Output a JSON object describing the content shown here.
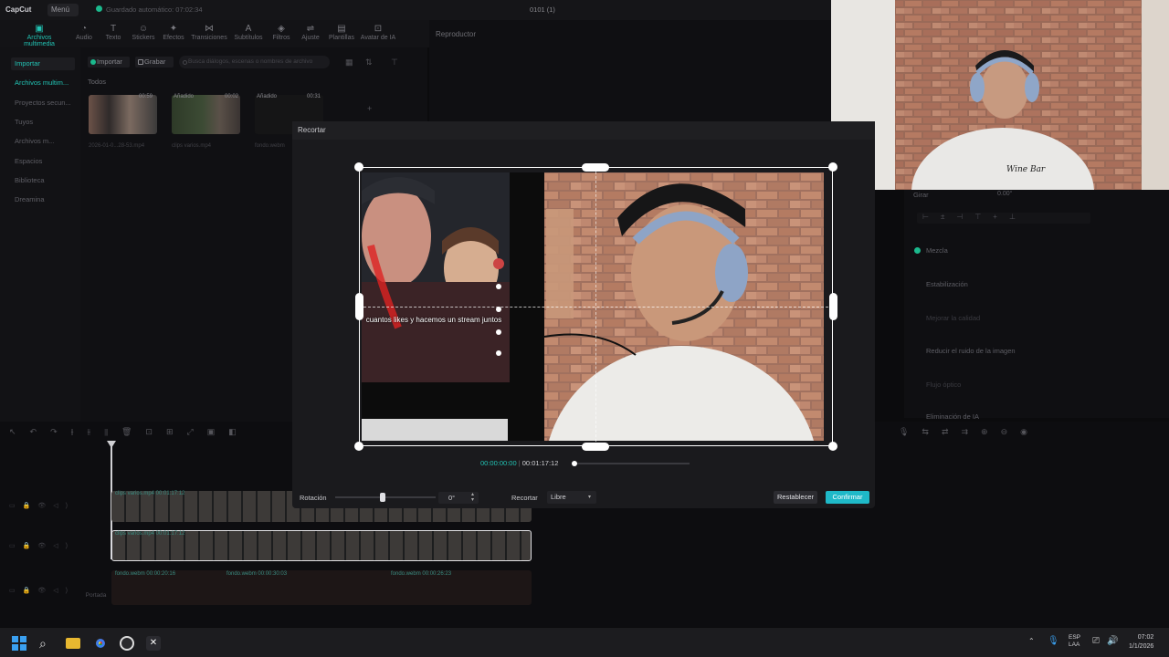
{
  "app": {
    "logo": "CapCut",
    "menu_label": "Menú",
    "autosave": "Guardado automático: 07:02:34",
    "project_title": "0101 (1)"
  },
  "toolbar": [
    {
      "label": "Archivos multimedia",
      "icon": "media-icon",
      "active": true
    },
    {
      "label": "Audio",
      "icon": "audio-icon"
    },
    {
      "label": "Texto",
      "icon": "text-icon"
    },
    {
      "label": "Stickers",
      "icon": "sticker-icon"
    },
    {
      "label": "Efectos",
      "icon": "effects-icon"
    },
    {
      "label": "Transiciones",
      "icon": "transitions-icon"
    },
    {
      "label": "Subtítulos",
      "icon": "subtitles-icon"
    },
    {
      "label": "Filtros",
      "icon": "filters-icon"
    },
    {
      "label": "Ajuste",
      "icon": "adjust-icon"
    },
    {
      "label": "Plantillas",
      "icon": "templates-icon"
    },
    {
      "label": "Avatar de IA",
      "icon": "ai-avatar-icon"
    }
  ],
  "sidebar": {
    "items": [
      {
        "label": "Importar",
        "selected": true
      },
      {
        "label": "Archivos multim...",
        "selected": false,
        "accent": true
      },
      {
        "label": "Proyectos secun..."
      },
      {
        "label": "Tuyos"
      },
      {
        "label": "Archivos m..."
      },
      {
        "label": "Espacios"
      },
      {
        "label": "Biblioteca"
      },
      {
        "label": "Dreamina"
      }
    ]
  },
  "media": {
    "import_label": "Importar",
    "record_label": "Grabar",
    "search_placeholder": "Busca diálogos, escenas o nombres de archivo",
    "all_label": "Todos",
    "thumbs": [
      {
        "name": "2026-01-0...28-53.mp4",
        "duration": "00:59",
        "badge": ""
      },
      {
        "name": "clips varios.mp4",
        "duration": "00:02",
        "badge": "Añadido"
      },
      {
        "name": "fondo.webm",
        "duration": "00:31",
        "badge": "Añadido"
      }
    ]
  },
  "player": {
    "title": "Reproductor"
  },
  "right_panel": {
    "rotate_label": "Girar",
    "rotate_value": "0.00°",
    "items": [
      "Mezcla",
      "Estabilización",
      "Mejorar la calidad",
      "Reducir el ruido de la imagen",
      "Flujo óptico",
      "Eliminación de IA"
    ]
  },
  "crop_modal": {
    "title": "Recortar",
    "caption": "cuantos likes y hacemos un stream juntos",
    "current_time": "00:00:00:00",
    "total_time": "00:01:17:12",
    "rotation_label": "Rotación",
    "rotation_value": "0°",
    "rotation_fraction": 0.47,
    "crop_label": "Recortar",
    "ratio_value": "Libre",
    "reset_label": "Restablecer",
    "confirm_label": "Confirmar"
  },
  "timeline": {
    "tracks": [
      {
        "label": "clips varios.mp4  00:01:17:12"
      },
      {
        "label": "clips varios.mp4  00:01:17:12"
      },
      {
        "label": "fondo.webm  00:00:20:16"
      }
    ],
    "extra_labels": [
      "fondo.webm  00:00:30:03",
      "fondo.webm  00:00:26:23"
    ],
    "cover_label": "Portada"
  },
  "taskbar": {
    "lang": "ESP",
    "lang2": "LAA",
    "time": "07:02",
    "date": "1/1/2026"
  },
  "colors": {
    "accent": "#22c3b4",
    "confirm": "#1fb9c8"
  }
}
